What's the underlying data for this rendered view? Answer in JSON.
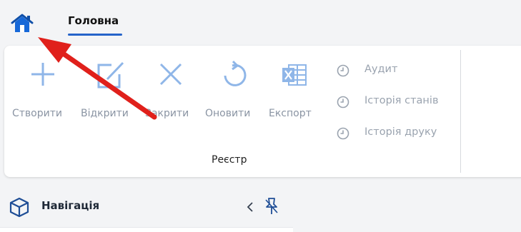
{
  "header": {
    "home_icon": "home-icon",
    "tab_home": "Головна",
    "accent_color": "#2563c9"
  },
  "ribbon": {
    "buttons": [
      {
        "label": "Створити",
        "icon": "plus-icon"
      },
      {
        "label": "Відкрити",
        "icon": "edit-icon"
      },
      {
        "label": "Закрити",
        "icon": "close-icon"
      },
      {
        "label": "Оновити",
        "icon": "refresh-icon"
      },
      {
        "label": "Експорт",
        "icon": "excel-icon"
      }
    ],
    "side_items": [
      {
        "label": "Аудит",
        "icon": "clock-icon"
      },
      {
        "label": "Історія станів",
        "icon": "clock-icon"
      },
      {
        "label": "Історія друку",
        "icon": "clock-icon"
      }
    ],
    "group_label": "Реєстр"
  },
  "navigation": {
    "title": "Навігація",
    "icon": "cube-icon",
    "collapse_icon": "chevron-left-icon",
    "pin_icon": "pin-icon"
  },
  "annotation": {
    "arrow_color": "#e0201b"
  }
}
